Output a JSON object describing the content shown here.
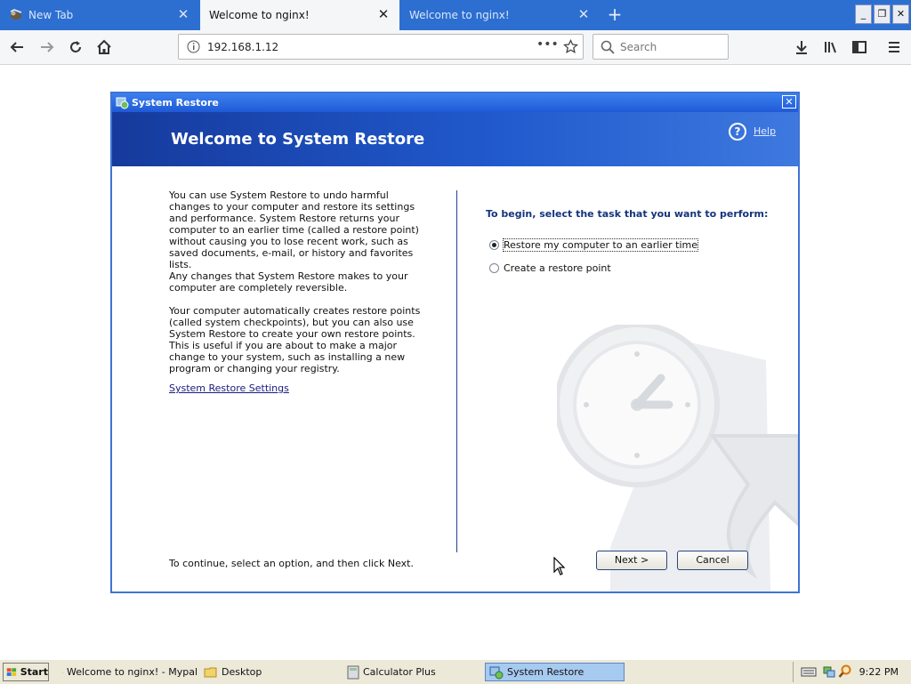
{
  "browser": {
    "tabs": [
      {
        "label": "New Tab",
        "active": false
      },
      {
        "label": "Welcome to nginx!",
        "active": true
      },
      {
        "label": "Welcome to nginx!",
        "active": false
      }
    ],
    "url": "192.168.1.12",
    "search_placeholder": "Search"
  },
  "dialog": {
    "window_title": "System Restore",
    "banner_title": "Welcome to System Restore",
    "help_label": "Help",
    "intro_paragraphs": [
      "You can use System Restore to undo harmful changes to your computer and restore its settings and performance. System Restore returns your computer to an earlier time (called a restore point) without causing you to lose recent work, such as saved documents, e-mail, or history and favorites lists.",
      "Any changes that System Restore makes to your computer are completely reversible.",
      "Your computer automatically creates restore points (called system checkpoints), but you can also use System Restore to create your own restore points. This is useful if you are about to make a major change to your system, such as installing a new program or changing your registry."
    ],
    "settings_link": "System Restore Settings",
    "continue_text": "To continue, select an option, and then click Next.",
    "task_heading": "To begin, select the task that you want to perform:",
    "options": [
      {
        "label": "Restore my computer to an earlier time",
        "selected": true
      },
      {
        "label": "Create a restore point",
        "selected": false
      }
    ],
    "next_label": "Next >",
    "cancel_label": "Cancel"
  },
  "taskbar": {
    "start_label": "Start",
    "items": [
      {
        "label": "Welcome to nginx! - Mypal",
        "icon": "mypal-icon",
        "active": false
      },
      {
        "label": "Desktop",
        "icon": "folder-icon",
        "active": false
      },
      {
        "label": "Calculator Plus",
        "icon": "calculator-icon",
        "active": false
      },
      {
        "label": "System Restore",
        "icon": "system-restore-icon",
        "active": true
      }
    ],
    "clock": "9:22 PM"
  },
  "colors": {
    "tab_strip": "#2d6fd0",
    "dialog_banner": "#1f4fbf",
    "taskbar": "#ece9d8"
  }
}
